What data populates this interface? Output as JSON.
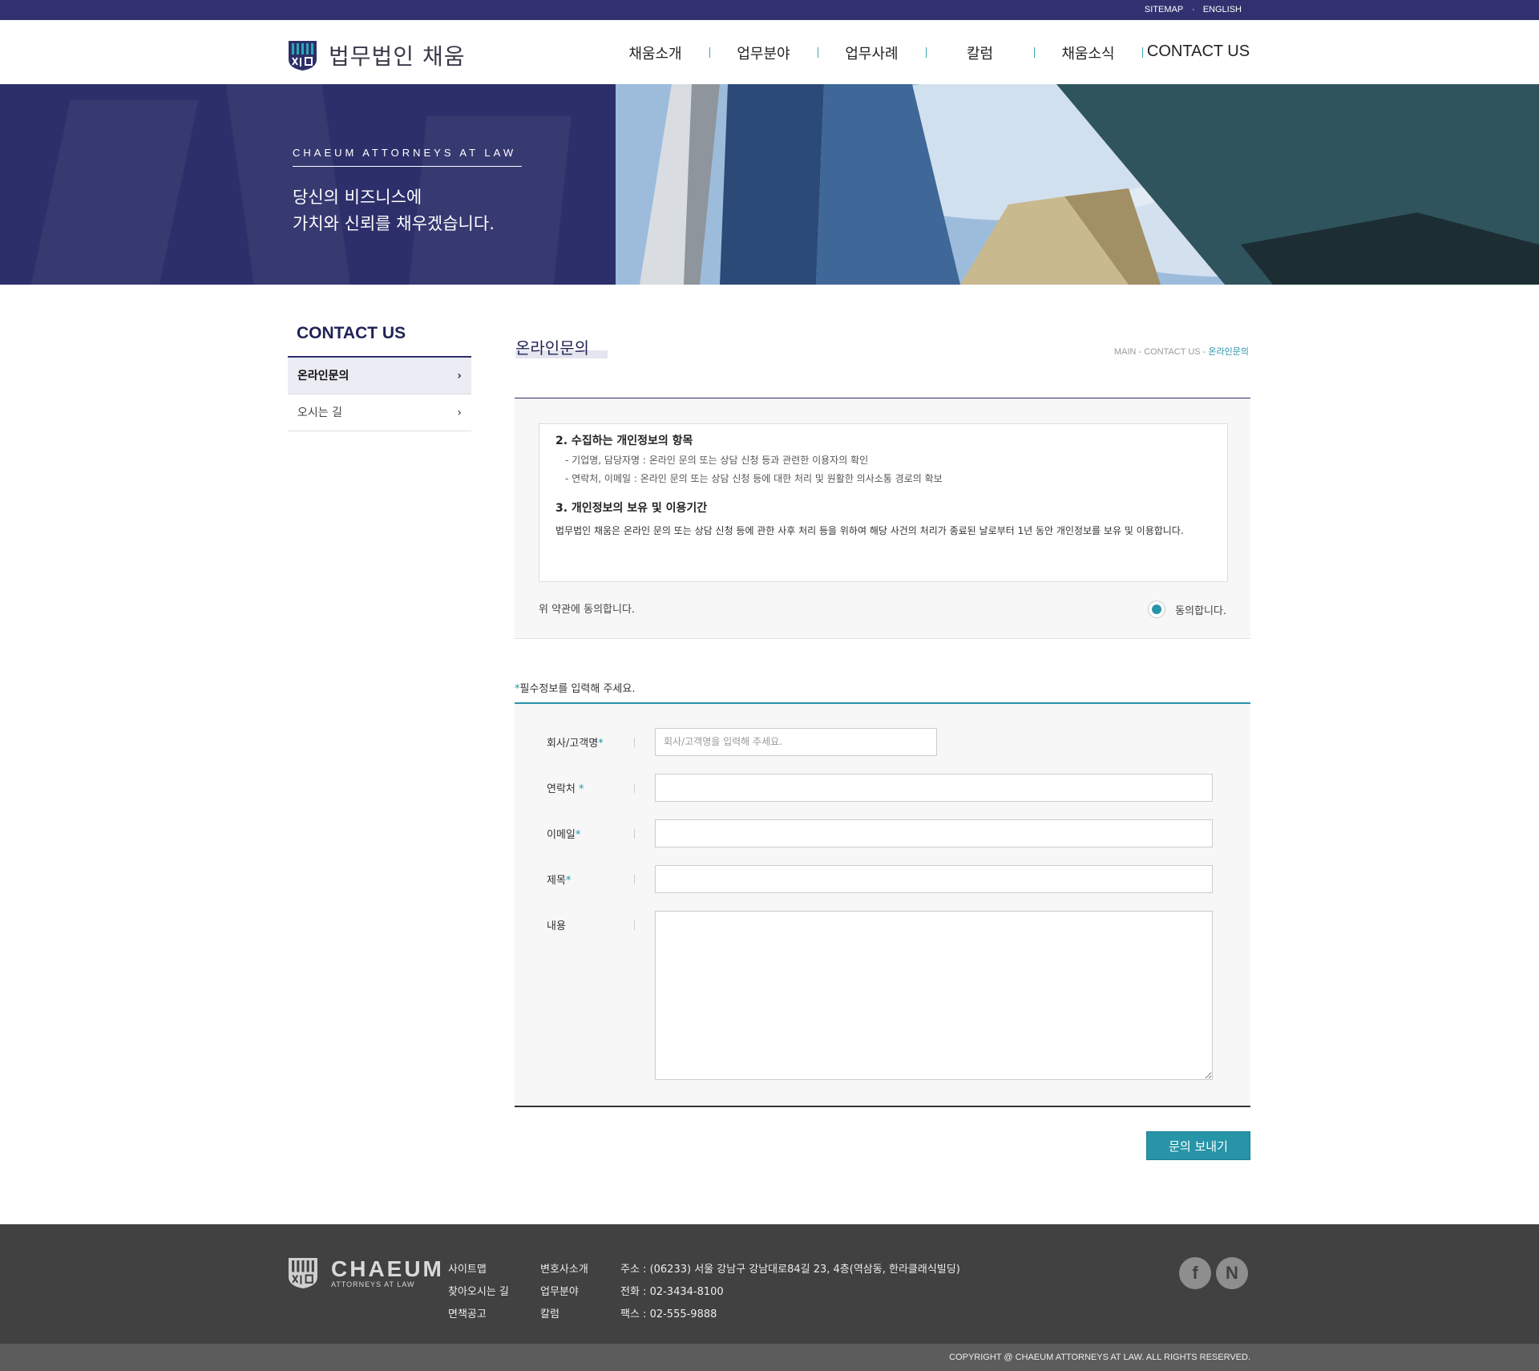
{
  "topbar": {
    "sitemap": "SITEMAP",
    "english": "ENGLISH"
  },
  "header": {
    "brand": "법무법인 채움",
    "nav": [
      "채움소개",
      "업무분야",
      "업무사례",
      "칼럼",
      "채움소식",
      "CONTACT US"
    ]
  },
  "hero": {
    "en_title": "CHAEUM ATTORNEYS AT LAW",
    "line1": "당신의 비즈니스에",
    "line2": "가치와 신뢰를 채우겠습니다."
  },
  "sidebar": {
    "title": "CONTACT US",
    "items": [
      {
        "label": "온라인문의",
        "active": true
      },
      {
        "label": "오시는 길",
        "active": false
      }
    ]
  },
  "page": {
    "title": "온라인문의",
    "breadcrumb": {
      "main": "MAIN",
      "sep": " - ",
      "section": "CONTACT US",
      "current": "온라인문의"
    }
  },
  "terms": {
    "h2": "2. 수집하는 개인정보의 항목",
    "item1": "기업명, 담당자명 : 온라인 문의 또는 상담 신청 등과 관련한 이용자의 확인",
    "item2": "연락처, 이메일 : 온라인 문의 또는 상담 신청 등에 대한 처리 및 원활한 의사소통 경로의 확보",
    "h3": "3. 개인정보의 보유 및 이용기간",
    "body": "법무법인 채움은 온라인 문의 또는 상담 신청 등에 관한 사후 처리 등을 위하여 해당 사건의 처리가 종료된 날로부터 1년 동안 개인정보를 보유 및 이용합니다.",
    "agree_label": "위 약관에 동의합니다.",
    "agree_option": "동의합니다."
  },
  "form": {
    "required_star": "*",
    "required_note": "필수정보를 입력해 주세요.",
    "company_label": "회사/고객명",
    "company_placeholder": "회사/고객명을 입력해 주세요.",
    "phone_label": "연락처 ",
    "email_label": "이메일",
    "subject_label": "제목",
    "content_label": "내용",
    "star": "*",
    "submit": "문의 보내기"
  },
  "footer": {
    "logo_big": "CHAEUM",
    "logo_small": "ATTORNEYS AT LAW",
    "col1": [
      "사이트맵",
      "찾아오시는 길",
      "면책공고"
    ],
    "col2": [
      "변호사소개",
      "업무분야",
      "칼럼"
    ],
    "address": "주소 : (06233) 서울 강남구 강남대로84길 23, 4층(역삼동, 한라클래식빌딩)",
    "tel": "전화 : 02-3434-8100",
    "fax": "팩스 : 02-555-9888",
    "copyright": "COPYRIGHT @ CHAEUM ATTORNEYS AT LAW. ALL RIGHTS RESERVED.",
    "sns": [
      {
        "icon": "facebook-icon",
        "glyph": "f"
      },
      {
        "icon": "naver-icon",
        "glyph": "N"
      }
    ]
  },
  "colors": {
    "navy": "#2d2f6a",
    "teal": "#2794a8",
    "footer": "#414141"
  }
}
